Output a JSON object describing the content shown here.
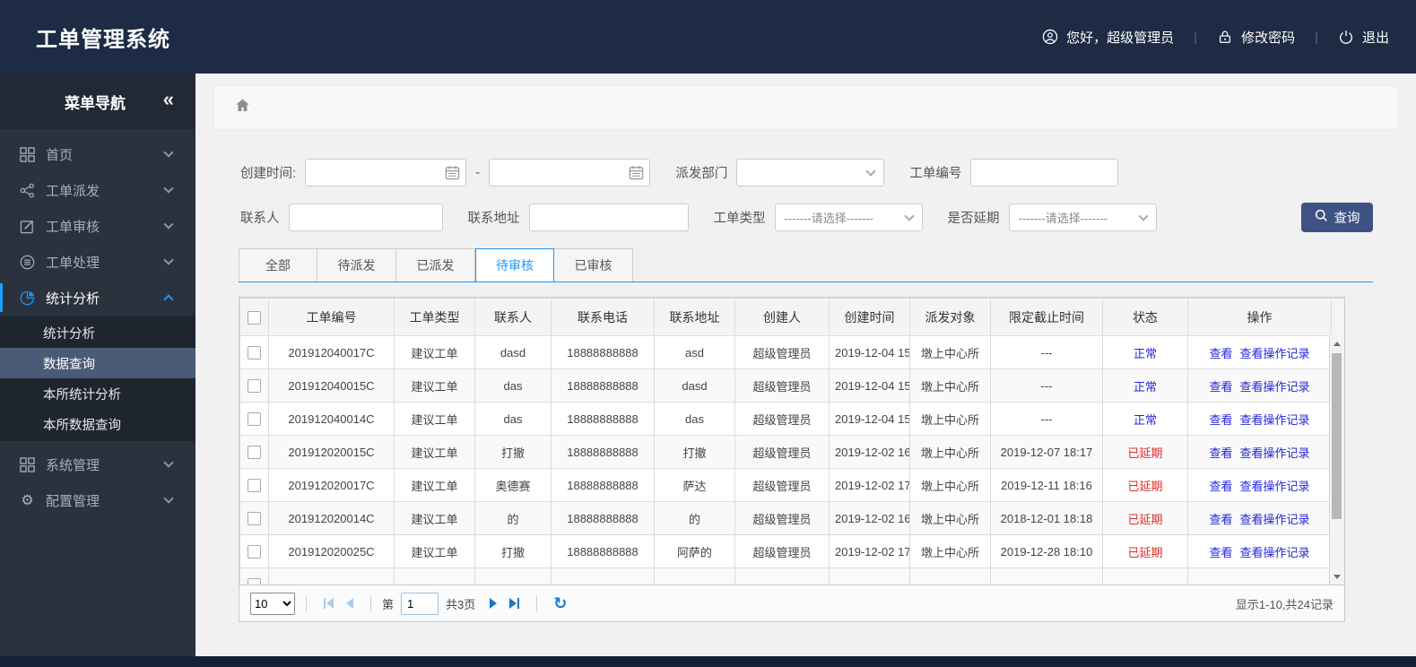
{
  "header": {
    "title": "工单管理系统",
    "greeting": "您好，超级管理员",
    "change_password": "修改密码",
    "logout": "退出",
    "separator": "|"
  },
  "sidebar": {
    "title": "菜单导航",
    "collapse_glyph": "«",
    "items": [
      {
        "label": "首页",
        "icon": "grid-icon"
      },
      {
        "label": "工单派发",
        "icon": "share-icon"
      },
      {
        "label": "工单审核",
        "icon": "edit-icon"
      },
      {
        "label": "工单处理",
        "icon": "process-icon"
      },
      {
        "label": "统计分析",
        "icon": "pie-icon",
        "active": true
      },
      {
        "label": "系统管理",
        "icon": "modules-icon"
      },
      {
        "label": "配置管理",
        "icon": "gear-icon"
      }
    ],
    "submenu": [
      {
        "label": "统计分析"
      },
      {
        "label": "数据查询",
        "selected": true
      },
      {
        "label": "本所统计分析"
      },
      {
        "label": "本所数据查询"
      }
    ],
    "gear_glyph": "⚙"
  },
  "filters": {
    "create_time_label": "创建时间:",
    "range_separator": "-",
    "dispatch_dept_label": "派发部门",
    "order_no_label": "工单编号",
    "contact_label": "联系人",
    "address_label": "联系地址",
    "order_type_label": "工单类型",
    "order_type_placeholder": "-------请选择-------",
    "delay_label": "是否延期",
    "delay_placeholder": "-------请选择-------",
    "search_button": "查询"
  },
  "tabs": [
    {
      "label": "全部"
    },
    {
      "label": "待派发"
    },
    {
      "label": "已派发"
    },
    {
      "label": "待审核",
      "active": true
    },
    {
      "label": "已审核"
    }
  ],
  "table": {
    "columns": [
      "工单编号",
      "工单类型",
      "联系人",
      "联系电话",
      "联系地址",
      "创建人",
      "创建时间",
      "派发对象",
      "限定截止时间",
      "状态",
      "操作"
    ],
    "rows": [
      {
        "order_no": "201912040017C",
        "order_type": "建议工单",
        "contact": "dasd",
        "phone": "18888888888",
        "address": "asd",
        "creator": "超级管理员",
        "created": "2019-12-04 15",
        "target": "墩上中心所",
        "deadline": "---",
        "status": "正常",
        "status_type": "normal",
        "actions": [
          "查看",
          "查看操作记录"
        ]
      },
      {
        "order_no": "201912040015C",
        "order_type": "建议工单",
        "contact": "das",
        "phone": "18888888888",
        "address": "dasd",
        "creator": "超级管理员",
        "created": "2019-12-04 15",
        "target": "墩上中心所",
        "deadline": "---",
        "status": "正常",
        "status_type": "normal",
        "actions": [
          "查看",
          "查看操作记录"
        ]
      },
      {
        "order_no": "201912040014C",
        "order_type": "建议工单",
        "contact": "das",
        "phone": "18888888888",
        "address": "das",
        "creator": "超级管理员",
        "created": "2019-12-04 15",
        "target": "墩上中心所",
        "deadline": "---",
        "status": "正常",
        "status_type": "normal",
        "actions": [
          "查看",
          "查看操作记录"
        ]
      },
      {
        "order_no": "201912020015C",
        "order_type": "建议工单",
        "contact": "打撤",
        "phone": "18888888888",
        "address": "打撤",
        "creator": "超级管理员",
        "created": "2019-12-02 16",
        "target": "墩上中心所",
        "deadline": "2019-12-07 18:17",
        "status": "已延期",
        "status_type": "delayed",
        "actions": [
          "查看",
          "查看操作记录"
        ]
      },
      {
        "order_no": "201912020017C",
        "order_type": "建议工单",
        "contact": "奥德赛",
        "phone": "18888888888",
        "address": "萨达",
        "creator": "超级管理员",
        "created": "2019-12-02 17",
        "target": "墩上中心所",
        "deadline": "2019-12-11 18:16",
        "status": "已延期",
        "status_type": "delayed",
        "actions": [
          "查看",
          "查看操作记录"
        ]
      },
      {
        "order_no": "201912020014C",
        "order_type": "建议工单",
        "contact": "的",
        "phone": "18888888888",
        "address": "的",
        "creator": "超级管理员",
        "created": "2019-12-02 16",
        "target": "墩上中心所",
        "deadline": "2018-12-01 18:18",
        "status": "已延期",
        "status_type": "delayed",
        "actions": [
          "查看",
          "查看操作记录"
        ]
      },
      {
        "order_no": "201912020025C",
        "order_type": "建议工单",
        "contact": "打撤",
        "phone": "18888888888",
        "address": "阿萨的",
        "creator": "超级管理员",
        "created": "2019-12-02 17",
        "target": "墩上中心所",
        "deadline": "2019-12-28 18:10",
        "status": "已延期",
        "status_type": "delayed",
        "actions": [
          "查看",
          "查看操作记录"
        ]
      }
    ]
  },
  "pagination": {
    "page_size": "10",
    "page_prefix": "第",
    "current_page": "1",
    "total_pages": "共3页",
    "refresh_glyph": "↻",
    "summary": "显示1-10,共24记录"
  },
  "colors": {
    "header_bg": "#1d2b44",
    "sidebar_bg": "#2a323e",
    "submenu_selected_bg": "#4a5b78",
    "active_blue": "#2196f3",
    "link_blue": "#2525dd",
    "status_normal": "#2525dd",
    "status_delayed": "#e02a2a",
    "search_button_bg": "#3e5383",
    "footer_bg": "#152137"
  }
}
